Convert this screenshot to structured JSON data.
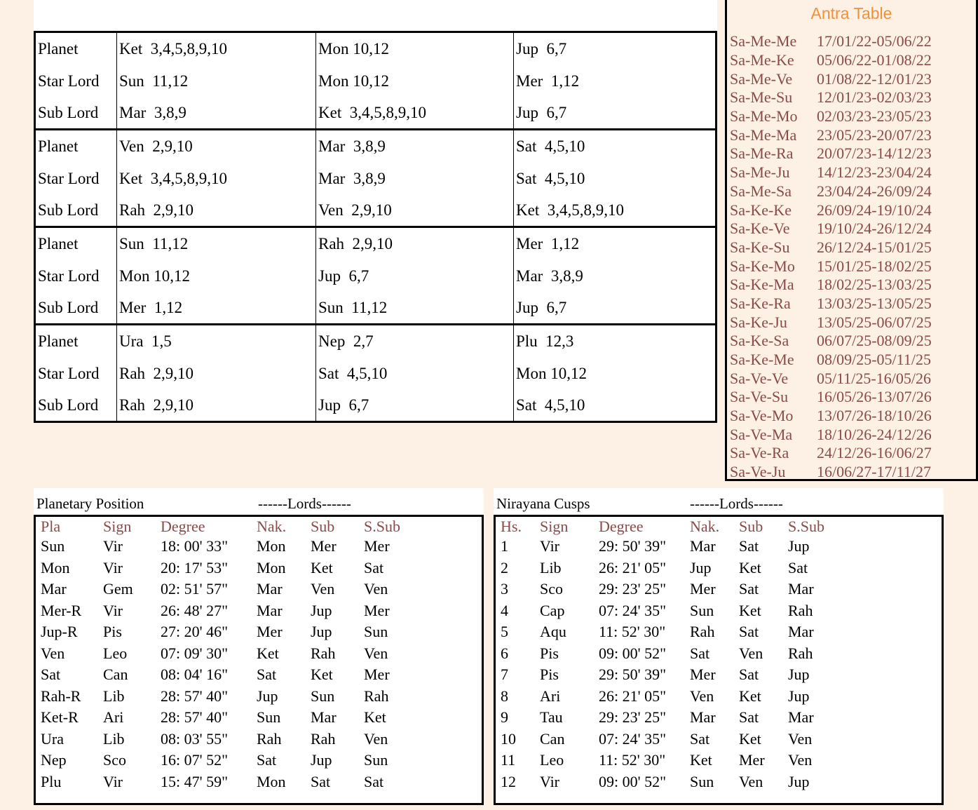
{
  "top_fragment": "--- ------",
  "significators": {
    "blocks": [
      {
        "rows": [
          {
            "label": "Planet",
            "cells": [
              "Ket  3,4,5,8,9,10",
              "Mon 10,12",
              "Jup  6,7"
            ]
          },
          {
            "label": "Star Lord",
            "cells": [
              "Sun  11,12",
              "Mon 10,12",
              "Mer  1,12"
            ]
          },
          {
            "label": "Sub Lord",
            "cells": [
              "Mar  3,8,9",
              "Ket  3,4,5,8,9,10",
              "Jup  6,7"
            ]
          }
        ]
      },
      {
        "rows": [
          {
            "label": "Planet",
            "cells": [
              "Ven  2,9,10",
              "Mar  3,8,9",
              "Sat  4,5,10"
            ]
          },
          {
            "label": "Star Lord",
            "cells": [
              "Ket  3,4,5,8,9,10",
              "Mar  3,8,9",
              "Sat  4,5,10"
            ]
          },
          {
            "label": "Sub Lord",
            "cells": [
              "Rah  2,9,10",
              "Ven  2,9,10",
              "Ket  3,4,5,8,9,10"
            ]
          }
        ]
      },
      {
        "rows": [
          {
            "label": "Planet",
            "cells": [
              "Sun  11,12",
              "Rah  2,9,10",
              "Mer  1,12"
            ]
          },
          {
            "label": "Star Lord",
            "cells": [
              "Mon 10,12",
              "Jup  6,7",
              "Mar  3,8,9"
            ]
          },
          {
            "label": "Sub Lord",
            "cells": [
              "Mer  1,12",
              "Sun  11,12",
              "Jup  6,7"
            ]
          }
        ]
      },
      {
        "rows": [
          {
            "label": "Planet",
            "cells": [
              "Ura  1,5",
              "Nep  2,7",
              "Plu  12,3"
            ]
          },
          {
            "label": "Star Lord",
            "cells": [
              "Rah  2,9,10",
              "Sat  4,5,10",
              "Mon 10,12"
            ]
          },
          {
            "label": "Sub Lord",
            "cells": [
              "Rah  2,9,10",
              "Jup  6,7",
              "Sat  4,5,10"
            ]
          }
        ]
      }
    ]
  },
  "antra": {
    "title": "Antra Table",
    "rows": [
      [
        "Sa-Me-Me",
        "17/01/22-05/06/22"
      ],
      [
        "Sa-Me-Ke",
        "05/06/22-01/08/22"
      ],
      [
        "Sa-Me-Ve",
        "01/08/22-12/01/23"
      ],
      [
        "Sa-Me-Su",
        "12/01/23-02/03/23"
      ],
      [
        "Sa-Me-Mo",
        "02/03/23-23/05/23"
      ],
      [
        "Sa-Me-Ma",
        "23/05/23-20/07/23"
      ],
      [
        "Sa-Me-Ra",
        "20/07/23-14/12/23"
      ],
      [
        "Sa-Me-Ju",
        "14/12/23-23/04/24"
      ],
      [
        "Sa-Me-Sa",
        "23/04/24-26/09/24"
      ],
      [
        "Sa-Ke-Ke",
        "26/09/24-19/10/24"
      ],
      [
        "Sa-Ke-Ve",
        "19/10/24-26/12/24"
      ],
      [
        "Sa-Ke-Su",
        "26/12/24-15/01/25"
      ],
      [
        "Sa-Ke-Mo",
        "15/01/25-18/02/25"
      ],
      [
        "Sa-Ke-Ma",
        "18/02/25-13/03/25"
      ],
      [
        "Sa-Ke-Ra",
        "13/03/25-13/05/25"
      ],
      [
        "Sa-Ke-Ju",
        "13/05/25-06/07/25"
      ],
      [
        "Sa-Ke-Sa",
        "06/07/25-08/09/25"
      ],
      [
        "Sa-Ke-Me",
        "08/09/25-05/11/25"
      ],
      [
        "Sa-Ve-Ve",
        "05/11/25-16/05/26"
      ],
      [
        "Sa-Ve-Su",
        "16/05/26-13/07/26"
      ],
      [
        "Sa-Ve-Mo",
        "13/07/26-18/10/26"
      ],
      [
        "Sa-Ve-Ma",
        "18/10/26-24/12/26"
      ],
      [
        "Sa-Ve-Ra",
        "24/12/26-16/06/27"
      ],
      [
        "Sa-Ve-Ju",
        "16/06/27-17/11/27"
      ]
    ]
  },
  "planetary": {
    "title": "Planetary Position",
    "lords_label": "------Lords------",
    "headers": [
      "Pla",
      "Sign",
      "Degree",
      "Nak.",
      "Sub",
      "S.Sub"
    ],
    "rows": [
      [
        "Sun",
        "Vir",
        "18: 00' 33\"",
        "Mon",
        "Mer",
        "Mer"
      ],
      [
        "Mon",
        "Vir",
        "20: 17' 53\"",
        "Mon",
        "Ket",
        "Sat"
      ],
      [
        "Mar",
        "Gem",
        "02: 51' 57\"",
        "Mar",
        "Ven",
        "Ven"
      ],
      [
        "Mer-R",
        "Vir",
        "26: 48' 27\"",
        "Mar",
        "Jup",
        "Mer"
      ],
      [
        "Jup-R",
        "Pis",
        "27: 20' 46\"",
        "Mer",
        "Jup",
        "Sun"
      ],
      [
        "Ven",
        "Leo",
        "07: 09' 30\"",
        "Ket",
        "Rah",
        "Ven"
      ],
      [
        "Sat",
        "Can",
        "08: 04' 16\"",
        "Sat",
        "Ket",
        "Mer"
      ],
      [
        "Rah-R",
        "Lib",
        "28: 57' 40\"",
        "Jup",
        "Sun",
        "Rah"
      ],
      [
        "Ket-R",
        "Ari",
        "28: 57' 40\"",
        "Sun",
        "Mar",
        "Ket"
      ],
      [
        "Ura",
        "Lib",
        "08: 03' 55\"",
        "Rah",
        "Rah",
        "Ven"
      ],
      [
        "Nep",
        "Sco",
        "16: 07' 52\"",
        "Sat",
        "Jup",
        "Sun"
      ],
      [
        "Plu",
        "Vir",
        "15: 47' 59\"",
        "Mon",
        "Sat",
        "Sat"
      ]
    ]
  },
  "cusps": {
    "title": "Nirayana Cusps",
    "lords_label": "------Lords------",
    "headers": [
      "Hs.",
      "Sign",
      "Degree",
      "Nak.",
      "Sub",
      "S.Sub"
    ],
    "rows": [
      [
        "1",
        "Vir",
        "29: 50' 39\"",
        "Mar",
        "Sat",
        "Jup"
      ],
      [
        "2",
        "Lib",
        "26: 21' 05\"",
        "Jup",
        "Ket",
        "Sat"
      ],
      [
        "3",
        "Sco",
        "29: 23' 25\"",
        "Mer",
        "Sat",
        "Mar"
      ],
      [
        "4",
        "Cap",
        "07: 24' 35\"",
        "Sun",
        "Ket",
        "Rah"
      ],
      [
        "5",
        "Aqu",
        "11: 52' 30\"",
        "Rah",
        "Sat",
        "Mar"
      ],
      [
        "6",
        "Pis",
        "09: 00' 52\"",
        "Sat",
        "Ven",
        "Rah"
      ],
      [
        "7",
        "Pis",
        "29: 50' 39\"",
        "Mer",
        "Sat",
        "Jup"
      ],
      [
        "8",
        "Ari",
        "26: 21' 05\"",
        "Ven",
        "Ket",
        "Jup"
      ],
      [
        "9",
        "Tau",
        "29: 23' 25\"",
        "Mar",
        "Sat",
        "Mar"
      ],
      [
        "10",
        "Can",
        "07: 24' 35\"",
        "Sat",
        "Ket",
        "Ven"
      ],
      [
        "11",
        "Leo",
        "11: 52' 30\"",
        "Ket",
        "Mer",
        "Ven"
      ],
      [
        "12",
        "Vir",
        "09: 00' 52\"",
        "Sun",
        "Ven",
        "Jup"
      ]
    ]
  }
}
